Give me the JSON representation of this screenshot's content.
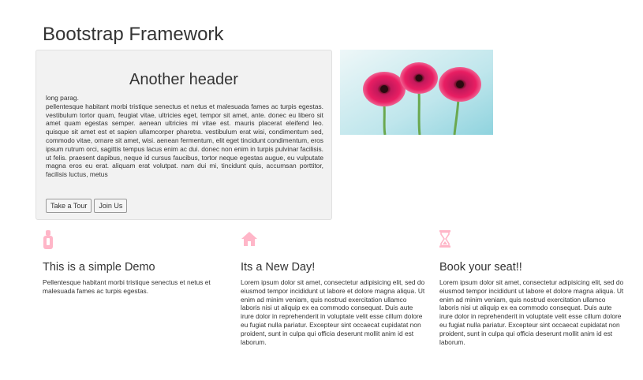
{
  "page": {
    "title": "Bootstrap Framework"
  },
  "jumbotron": {
    "header": "Another header",
    "lead": "long parag.",
    "body": "pellentesque habitant morbi tristique senectus et netus et malesuada fames ac turpis egestas. vestibulum tortor quam, feugiat vitae, ultricies eget, tempor sit amet, ante. donec eu libero sit amet quam egestas semper. aenean ultricies mi vitae est. mauris placerat eleifend leo. quisque sit amet est et sapien ullamcorper pharetra. vestibulum erat wisi, condimentum sed, commodo vitae, ornare sit amet, wisi. aenean fermentum, elit eget tincidunt condimentum, eros ipsum rutrum orci, sagittis tempus lacus enim ac dui. donec non enim in turpis pulvinar facilisis. ut felis. praesent dapibus, neque id cursus faucibus, tortor neque egestas augue, eu vulputate magna eros eu erat. aliquam erat volutpat. nam dui mi, tincidunt quis, accumsan porttitor, facilisis luctus, metus",
    "buttons": {
      "tour": "Take a Tour",
      "join": "Join Us"
    }
  },
  "image": {
    "icon": "pink-gerbera-flowers-photo"
  },
  "colors": {
    "icon_pink": "#ffb6c8",
    "jumbotron_bg": "#f2f2f2"
  },
  "features": [
    {
      "icon": "thermometer-icon",
      "title": "This is a simple Demo",
      "text": "Pellentesque habitant morbi tristique senectus et netus et malesuada fames ac turpis egestas."
    },
    {
      "icon": "home-icon",
      "title": "Its a New Day!",
      "text": "Lorem ipsum dolor sit amet, consectetur adipisicing elit, sed do eiusmod tempor incididunt ut labore et dolore magna aliqua. Ut enim ad minim veniam, quis nostrud exercitation ullamco laboris nisi ut aliquip ex ea commodo consequat. Duis aute irure dolor in reprehenderit in voluptate velit esse cillum dolore eu fugiat nulla pariatur. Excepteur sint occaecat cupidatat non proident, sunt in culpa qui officia deserunt mollit anim id est laborum."
    },
    {
      "icon": "hourglass-icon",
      "title": "Book your seat!!",
      "text": "Lorem ipsum dolor sit amet, consectetur adipisicing elit, sed do eiusmod tempor incididunt ut labore et dolore magna aliqua. Ut enim ad minim veniam, quis nostrud exercitation ullamco laboris nisi ut aliquip ex ea commodo consequat. Duis aute irure dolor in reprehenderit in voluptate velit esse cillum dolore eu fugiat nulla pariatur. Excepteur sint occaecat cupidatat non proident, sunt in culpa qui officia deserunt mollit anim id est laborum."
    }
  ]
}
